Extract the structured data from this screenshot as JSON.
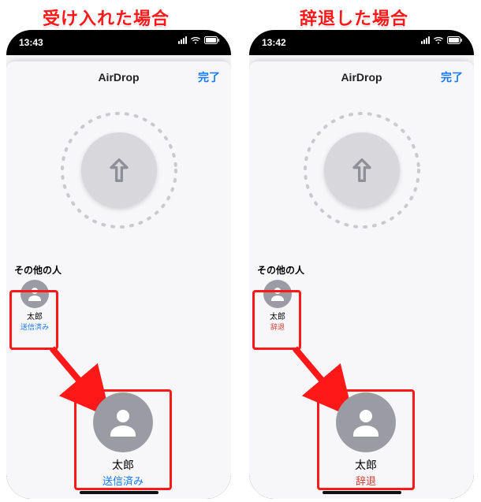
{
  "left": {
    "caption": "受け入れた場合",
    "caption_color": "#ff1818",
    "time": "13:43",
    "nav_title": "AirDrop",
    "done": "完了",
    "section": "その他の人",
    "contact": {
      "name": "太郎",
      "status": "送信済み",
      "status_class": "status-blue"
    },
    "large_contact": {
      "name": "太郎",
      "status": "送信済み",
      "status_class": "status-blue"
    }
  },
  "right": {
    "caption": "辞退した場合",
    "caption_color": "#ff1818",
    "time": "13:42",
    "nav_title": "AirDrop",
    "done": "完了",
    "section": "その他の人",
    "contact": {
      "name": "太郎",
      "status": "辞退",
      "status_class": "status-red"
    },
    "large_contact": {
      "name": "太郎",
      "status": "辞退",
      "status_class": "status-red"
    }
  }
}
